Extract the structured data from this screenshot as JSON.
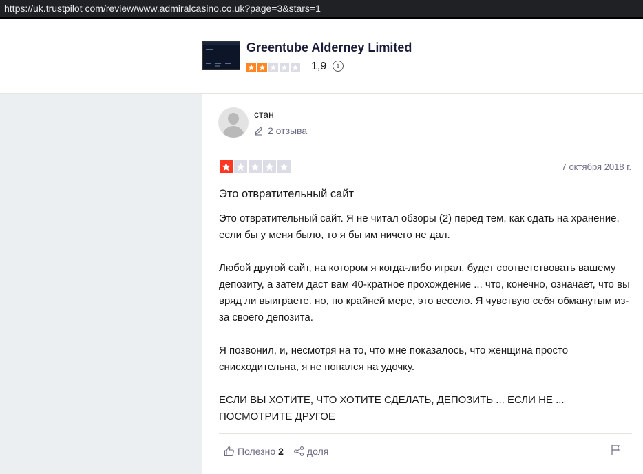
{
  "browser": {
    "url": "https://uk.trustpilot com/review/www.admiralcasino.co.uk?page=3&stars=1"
  },
  "company": {
    "name": "Greentube Alderney Limited",
    "rating": "1,9",
    "stars_filled": 2,
    "stars_total": 5,
    "star_color": "#ff8622",
    "info_icon": "info-icon"
  },
  "review": {
    "user_name": "стан",
    "review_count": "2 отзыва",
    "stars_filled": 1,
    "stars_total": 5,
    "star_color": "#ff3722",
    "date": "7 октября 2018 г.",
    "title": "Это отвратительный сайт",
    "paragraphs": [
      "Это отвратительный сайт. Я не читал обзоры (2) перед тем, как сдать на хранение, если бы у меня было, то я бы им ничего не дал.",
      "Любой другой сайт, на котором я когда-либо играл, будет соответствовать вашему депозиту, а затем даст вам 40-кратное прохождение ... что, конечно, означает, что вы вряд ли выиграете. но, по крайней мере, это весело. Я чувствую себя обманутым из-за своего депозита.",
      "Я позвонил, и, несмотря на то, что мне показалось, что женщина просто снисходительна, я не попался на удочку.",
      "ЕСЛИ ВЫ ХОТИТЕ, ЧТО ХОТИТЕ СДЕЛАТЬ, ДЕПОЗИТЬ ... ЕСЛИ НЕ ... ПОСМОТРИТЕ ДРУГОЕ"
    ],
    "useful_label": "Полезно",
    "useful_count": "2",
    "share_label": "доля"
  }
}
